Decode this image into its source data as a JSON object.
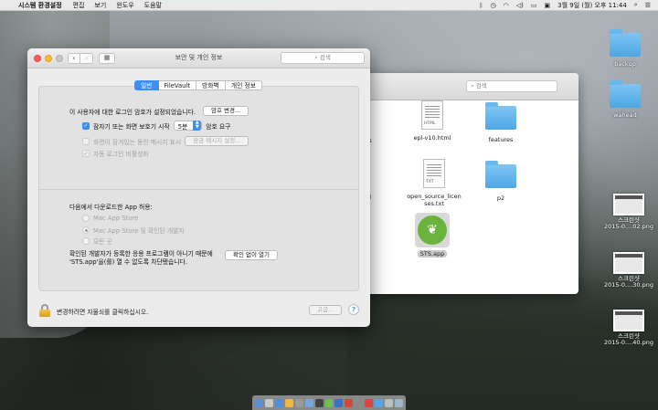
{
  "menubar": {
    "app_name": "시스템 환경설정",
    "menus": [
      "편집",
      "보기",
      "윈도우",
      "도움말"
    ],
    "clock": "3월 9일 (월) 오후  11:44"
  },
  "desktop_items": [
    {
      "label": "backup"
    },
    {
      "label": "wahead"
    },
    {
      "label": "스크린샷\n2015-0....02.png"
    },
    {
      "label": "스크린샷\n2015-0....30.png"
    },
    {
      "label": "스크린샷\n2015-0....40.png"
    }
  ],
  "finder": {
    "search_placeholder": "검색",
    "items": [
      {
        "label": "epl-v10.html",
        "tag": "HTML"
      },
      {
        "label": "features"
      },
      {
        "label": "open_source_licenses.txt",
        "tag": "TXT"
      },
      {
        "label": "p2"
      },
      {
        "label": "STS.app"
      }
    ],
    "clipped_labels": [
      "s",
      "ml"
    ]
  },
  "security": {
    "title": "보안 및 개인 정보",
    "search_placeholder": "검색",
    "tabs": [
      "일반",
      "FileVault",
      "방화벽",
      "개인 정보"
    ],
    "password_set_text": "이 사용자에 대한 로그인 암호가 설정되었습니다.",
    "change_password_button": "암호 변경...",
    "require_password_label": "잠자기 또는 화면 보호기 시작",
    "require_password_value": "5분",
    "require_password_suffix": "암호 요구",
    "show_message_label": "화면이 잠겨있는 동안 메시지 표시",
    "set_lock_message_button": "잠금 메시지 설정...",
    "disable_auto_login_label": "자동 로그인 비활성화",
    "allow_apps_label": "다음에서 다운로드한 App 허용:",
    "radio_options": [
      "Mac App Store",
      "Mac App Store 및 확인된 개발자",
      "모든 곳"
    ],
    "blocked_message_line1": "확인된 개발자가 등록한 응용 프로그램이 아니기 때문에",
    "blocked_message_line2": "'STS.app'을(를) 열 수 없도록 차단됐습니다.",
    "open_anyway_button": "확인 없이 열기",
    "lock_text": "변경하려면 자물쇠를 클릭하십시오.",
    "advanced_button": "고급...",
    "help_label": "?"
  }
}
